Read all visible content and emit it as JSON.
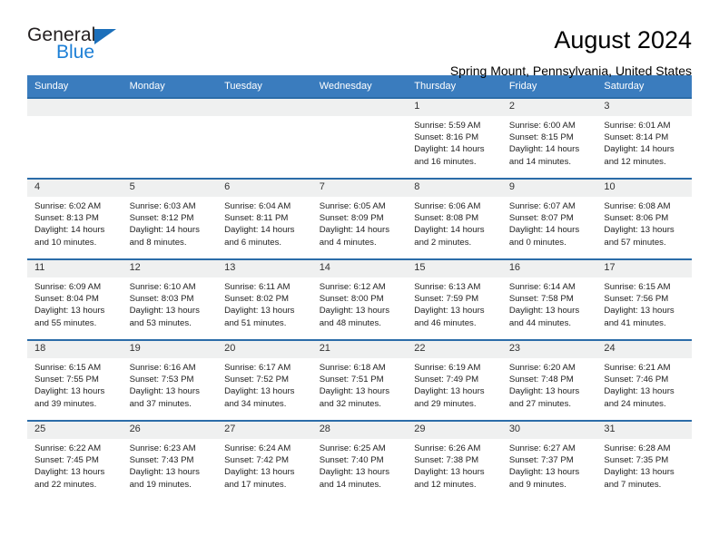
{
  "brand": {
    "name_part1": "General",
    "name_part2": "Blue",
    "triangle_color": "#1c6fba",
    "blue_color": "#1c7fd6"
  },
  "header": {
    "month_title": "August 2024",
    "location": "Spring Mount, Pennsylvania, United States"
  },
  "calendar": {
    "header_bg": "#3a7cbe",
    "row_border_color": "#2b6ca8",
    "day_band_bg": "#eff0f0",
    "weekdays": [
      "Sunday",
      "Monday",
      "Tuesday",
      "Wednesday",
      "Thursday",
      "Friday",
      "Saturday"
    ],
    "weeks": [
      [
        {
          "day": "",
          "lines": []
        },
        {
          "day": "",
          "lines": []
        },
        {
          "day": "",
          "lines": []
        },
        {
          "day": "",
          "lines": []
        },
        {
          "day": "1",
          "lines": [
            "Sunrise: 5:59 AM",
            "Sunset: 8:16 PM",
            "Daylight: 14 hours",
            "and 16 minutes."
          ]
        },
        {
          "day": "2",
          "lines": [
            "Sunrise: 6:00 AM",
            "Sunset: 8:15 PM",
            "Daylight: 14 hours",
            "and 14 minutes."
          ]
        },
        {
          "day": "3",
          "lines": [
            "Sunrise: 6:01 AM",
            "Sunset: 8:14 PM",
            "Daylight: 14 hours",
            "and 12 minutes."
          ]
        }
      ],
      [
        {
          "day": "4",
          "lines": [
            "Sunrise: 6:02 AM",
            "Sunset: 8:13 PM",
            "Daylight: 14 hours",
            "and 10 minutes."
          ]
        },
        {
          "day": "5",
          "lines": [
            "Sunrise: 6:03 AM",
            "Sunset: 8:12 PM",
            "Daylight: 14 hours",
            "and 8 minutes."
          ]
        },
        {
          "day": "6",
          "lines": [
            "Sunrise: 6:04 AM",
            "Sunset: 8:11 PM",
            "Daylight: 14 hours",
            "and 6 minutes."
          ]
        },
        {
          "day": "7",
          "lines": [
            "Sunrise: 6:05 AM",
            "Sunset: 8:09 PM",
            "Daylight: 14 hours",
            "and 4 minutes."
          ]
        },
        {
          "day": "8",
          "lines": [
            "Sunrise: 6:06 AM",
            "Sunset: 8:08 PM",
            "Daylight: 14 hours",
            "and 2 minutes."
          ]
        },
        {
          "day": "9",
          "lines": [
            "Sunrise: 6:07 AM",
            "Sunset: 8:07 PM",
            "Daylight: 14 hours",
            "and 0 minutes."
          ]
        },
        {
          "day": "10",
          "lines": [
            "Sunrise: 6:08 AM",
            "Sunset: 8:06 PM",
            "Daylight: 13 hours",
            "and 57 minutes."
          ]
        }
      ],
      [
        {
          "day": "11",
          "lines": [
            "Sunrise: 6:09 AM",
            "Sunset: 8:04 PM",
            "Daylight: 13 hours",
            "and 55 minutes."
          ]
        },
        {
          "day": "12",
          "lines": [
            "Sunrise: 6:10 AM",
            "Sunset: 8:03 PM",
            "Daylight: 13 hours",
            "and 53 minutes."
          ]
        },
        {
          "day": "13",
          "lines": [
            "Sunrise: 6:11 AM",
            "Sunset: 8:02 PM",
            "Daylight: 13 hours",
            "and 51 minutes."
          ]
        },
        {
          "day": "14",
          "lines": [
            "Sunrise: 6:12 AM",
            "Sunset: 8:00 PM",
            "Daylight: 13 hours",
            "and 48 minutes."
          ]
        },
        {
          "day": "15",
          "lines": [
            "Sunrise: 6:13 AM",
            "Sunset: 7:59 PM",
            "Daylight: 13 hours",
            "and 46 minutes."
          ]
        },
        {
          "day": "16",
          "lines": [
            "Sunrise: 6:14 AM",
            "Sunset: 7:58 PM",
            "Daylight: 13 hours",
            "and 44 minutes."
          ]
        },
        {
          "day": "17",
          "lines": [
            "Sunrise: 6:15 AM",
            "Sunset: 7:56 PM",
            "Daylight: 13 hours",
            "and 41 minutes."
          ]
        }
      ],
      [
        {
          "day": "18",
          "lines": [
            "Sunrise: 6:15 AM",
            "Sunset: 7:55 PM",
            "Daylight: 13 hours",
            "and 39 minutes."
          ]
        },
        {
          "day": "19",
          "lines": [
            "Sunrise: 6:16 AM",
            "Sunset: 7:53 PM",
            "Daylight: 13 hours",
            "and 37 minutes."
          ]
        },
        {
          "day": "20",
          "lines": [
            "Sunrise: 6:17 AM",
            "Sunset: 7:52 PM",
            "Daylight: 13 hours",
            "and 34 minutes."
          ]
        },
        {
          "day": "21",
          "lines": [
            "Sunrise: 6:18 AM",
            "Sunset: 7:51 PM",
            "Daylight: 13 hours",
            "and 32 minutes."
          ]
        },
        {
          "day": "22",
          "lines": [
            "Sunrise: 6:19 AM",
            "Sunset: 7:49 PM",
            "Daylight: 13 hours",
            "and 29 minutes."
          ]
        },
        {
          "day": "23",
          "lines": [
            "Sunrise: 6:20 AM",
            "Sunset: 7:48 PM",
            "Daylight: 13 hours",
            "and 27 minutes."
          ]
        },
        {
          "day": "24",
          "lines": [
            "Sunrise: 6:21 AM",
            "Sunset: 7:46 PM",
            "Daylight: 13 hours",
            "and 24 minutes."
          ]
        }
      ],
      [
        {
          "day": "25",
          "lines": [
            "Sunrise: 6:22 AM",
            "Sunset: 7:45 PM",
            "Daylight: 13 hours",
            "and 22 minutes."
          ]
        },
        {
          "day": "26",
          "lines": [
            "Sunrise: 6:23 AM",
            "Sunset: 7:43 PM",
            "Daylight: 13 hours",
            "and 19 minutes."
          ]
        },
        {
          "day": "27",
          "lines": [
            "Sunrise: 6:24 AM",
            "Sunset: 7:42 PM",
            "Daylight: 13 hours",
            "and 17 minutes."
          ]
        },
        {
          "day": "28",
          "lines": [
            "Sunrise: 6:25 AM",
            "Sunset: 7:40 PM",
            "Daylight: 13 hours",
            "and 14 minutes."
          ]
        },
        {
          "day": "29",
          "lines": [
            "Sunrise: 6:26 AM",
            "Sunset: 7:38 PM",
            "Daylight: 13 hours",
            "and 12 minutes."
          ]
        },
        {
          "day": "30",
          "lines": [
            "Sunrise: 6:27 AM",
            "Sunset: 7:37 PM",
            "Daylight: 13 hours",
            "and 9 minutes."
          ]
        },
        {
          "day": "31",
          "lines": [
            "Sunrise: 6:28 AM",
            "Sunset: 7:35 PM",
            "Daylight: 13 hours",
            "and 7 minutes."
          ]
        }
      ]
    ]
  }
}
